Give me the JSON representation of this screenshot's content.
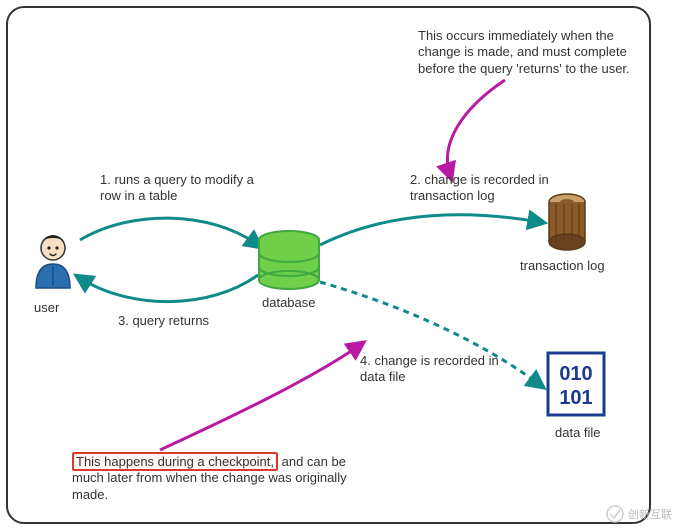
{
  "labels": {
    "user": "user",
    "database": "database",
    "txlog": "transaction log",
    "datafile": "data file",
    "step1": "1. runs a query to modify a row in a table",
    "step2": "2. change is recorded in transaction log",
    "step3": "3. query returns",
    "step4": "4. change is recorded in data file",
    "note_top": "This occurs immediately when the change is made, and must complete before the query 'returns' to the user.",
    "note_bottom_hl": "This happens during a checkpoint,",
    "note_bottom_rest": " and can be much later from when the change was originally made."
  },
  "datafile_bits": {
    "row1": "010",
    "row2": "101"
  },
  "watermark": "创新互联",
  "colors": {
    "teal": "#0f8a8a",
    "magenta": "#b81aa4",
    "green": "#6fcf4a",
    "dbdark": "#3fa840",
    "navy": "#1a3b8f",
    "brown": "#8a5a2b"
  }
}
